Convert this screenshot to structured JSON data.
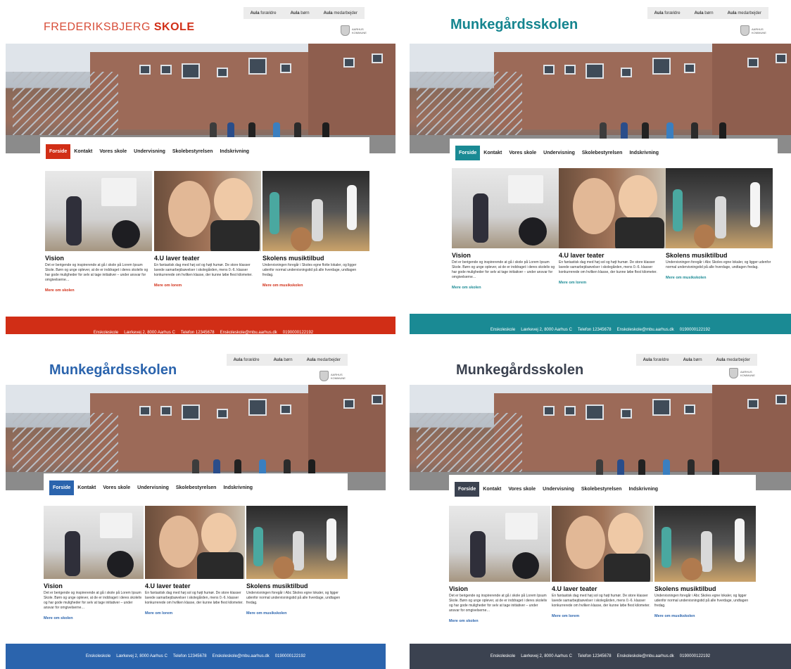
{
  "login": {
    "parents": {
      "prefix": "Aula",
      "label": "forældre"
    },
    "children": {
      "prefix": "Aula",
      "label": "børn"
    },
    "staff": {
      "prefix": "Aula",
      "label": "medarbejder"
    }
  },
  "crest_text": "AARHUS KOMMUNE",
  "nav": [
    "Forside",
    "Kontakt",
    "Vores skole",
    "Undervisning",
    "Skolebestyrelsen",
    "Indskrivning"
  ],
  "cards": [
    {
      "title": "Vision",
      "text": "Det er berigende og inspirerende at gå i skole på Lorem Ipsum Skole. Børn og unge oplever, at de er inddraget i deres skoleliv og har gode muligheder for selv at tage initiativer – under ansvar for omgivelserne…",
      "link": "Mere om skolen"
    },
    {
      "title": "4.U laver teater",
      "text": "En fantastisk dag med høj sol og højt humør. De store klasser lavede samarbejdsøvelser i skolegården, mens 0.-6. klasser konkurrerede om hvilken klasse, der kunne løbe flest kilometer.",
      "link": "Mere om lorem"
    },
    {
      "title": "Skolens musiktilbud",
      "text_a": "Undervisningen foregår i Skoles egne flotte lokaler, og ligger udenfor normal undervisningstid på alle hverdage, undtagen fredag.",
      "text_b": "Undervisningen foregår i Abc Skoles egne lokaler, og ligger udenfor normal undervisningstid på alle hverdage, undtagen fredag.",
      "link": "Mere om musikskolen"
    }
  ],
  "footer": {
    "name": "Enskoleskole",
    "address": "Lærkevej 2, 8000 Aarhus C",
    "phone": "Telefon 12345678",
    "email": "Enskoleskole@mbu.aarhus.dk",
    "number": "0190000122192"
  },
  "variants": [
    {
      "logo": "FREDERIKSBJERG SKOLE",
      "logo_light": "FREDERIKSBJERG",
      "logo_bold": "SKOLE",
      "accent": "#d12e16",
      "logo_color": "#d12e16"
    },
    {
      "logo": "Munkegårdsskolen",
      "accent": "#1a8a94",
      "logo_color": "#15858f"
    },
    {
      "logo": "Munkegårdsskolen",
      "accent": "#2b64ad",
      "logo_color": "#2b64ad"
    },
    {
      "logo": "Munkegårdsskolen",
      "accent": "#3b4250",
      "logo_color": "#3b4250"
    }
  ]
}
